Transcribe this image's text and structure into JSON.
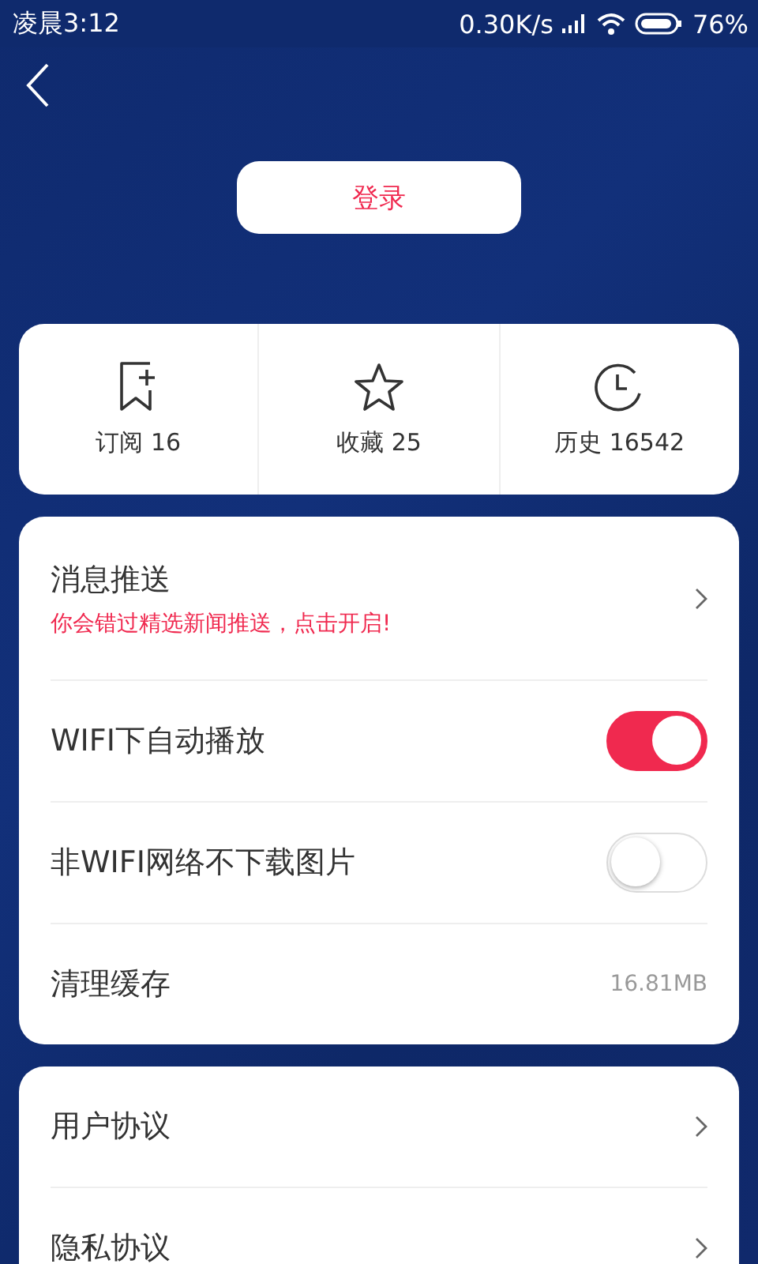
{
  "status_bar": {
    "time": "凌晨3:12",
    "speed": "0.30K/s",
    "battery": "76%"
  },
  "login_button": "登录",
  "stats": [
    {
      "kind": "subscribe",
      "label": "订阅 16"
    },
    {
      "kind": "favorite",
      "label": "收藏 25"
    },
    {
      "kind": "history",
      "label": "历史 16542"
    }
  ],
  "settings": [
    {
      "kind": "link",
      "title": "消息推送",
      "subtitle": "你会错过精选新闻推送，点击开启!"
    },
    {
      "kind": "toggle",
      "title": "WIFI下自动播放",
      "on": true
    },
    {
      "kind": "toggle",
      "title": "非WIFI网络不下载图片",
      "on": false
    },
    {
      "kind": "value",
      "title": "清理缓存",
      "value": "16.81MB"
    }
  ],
  "links": [
    {
      "title": "用户协议"
    },
    {
      "title": "隐私协议"
    }
  ]
}
